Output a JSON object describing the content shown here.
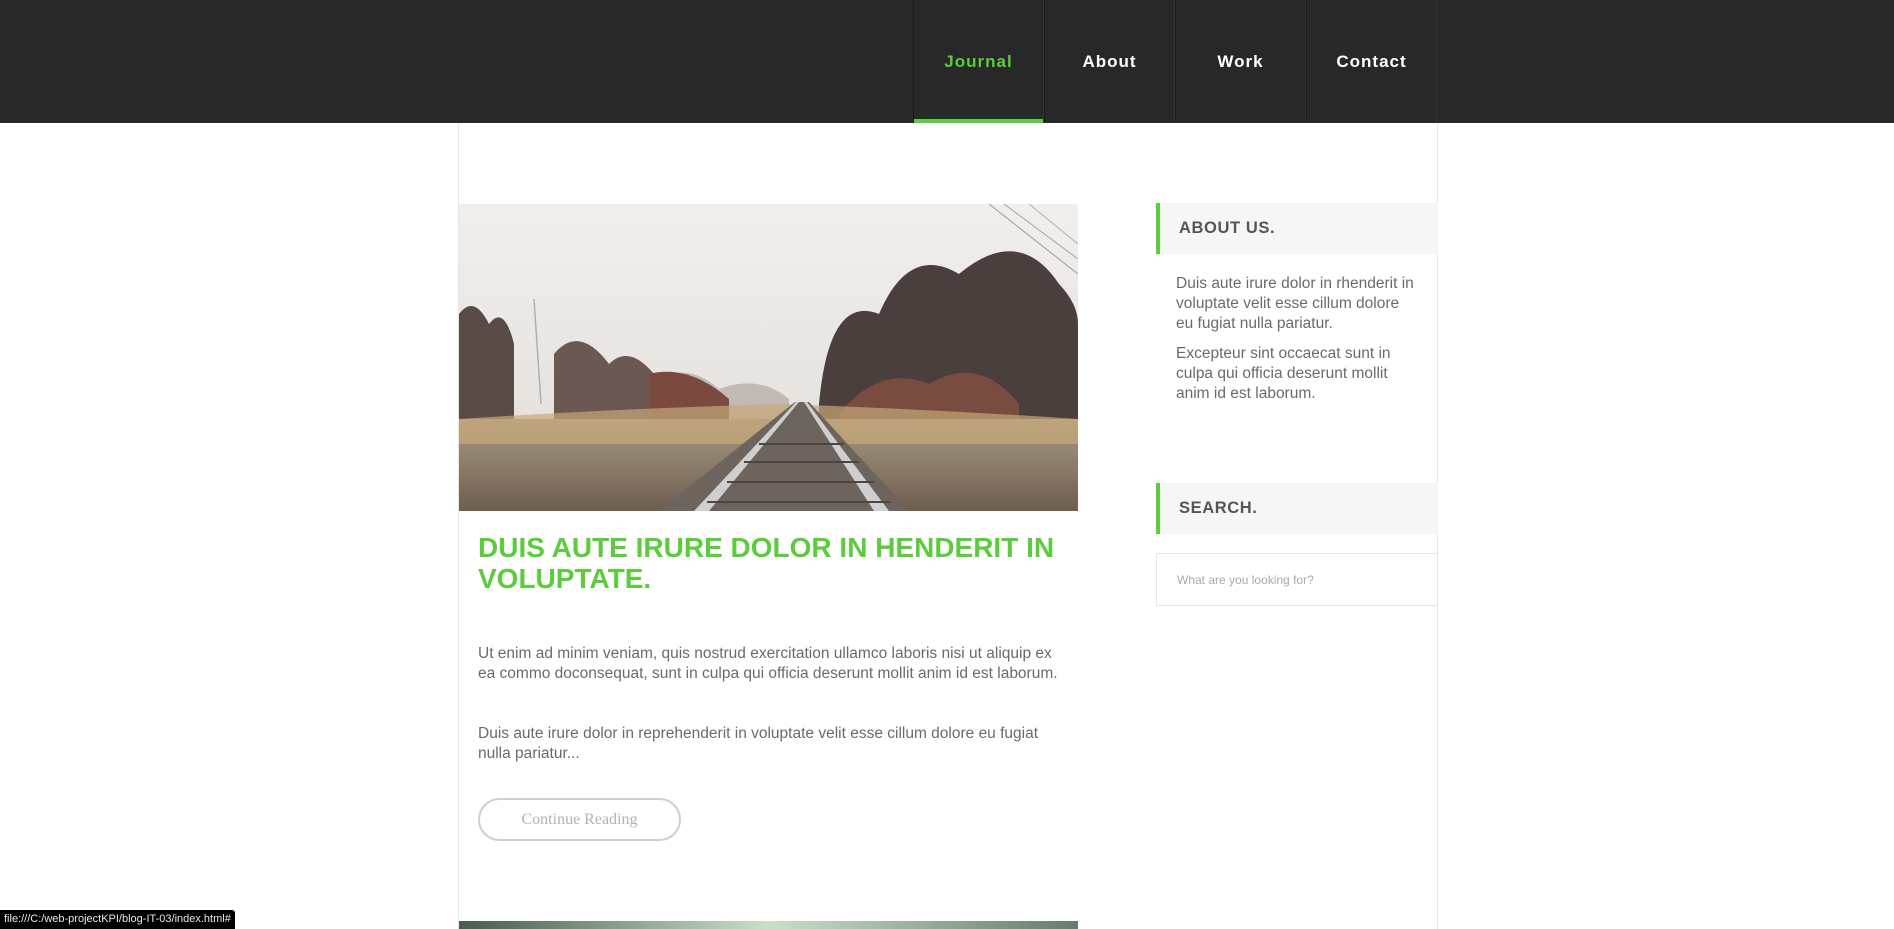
{
  "nav": {
    "items": [
      {
        "label": "Journal",
        "active": true
      },
      {
        "label": "About",
        "active": false
      },
      {
        "label": "Work",
        "active": false
      },
      {
        "label": "Contact",
        "active": false
      }
    ]
  },
  "post": {
    "image_alt": "railway-tracks-image",
    "title": "DUIS AUTE IRURE DOLOR IN HENDERIT IN VOLUPTATE.",
    "paragraphs": [
      "Ut enim ad minim veniam, quis nostrud exercitation ullamco laboris nisi ut aliquip ex ea commo doconsequat, sunt in culpa qui officia deserunt mollit anim id est laborum.",
      "Duis aute irure dolor in reprehenderit in voluptate velit esse cillum dolore eu fugiat nulla pariatur..."
    ],
    "continue_label": "Continue Reading"
  },
  "sidebar": {
    "about": {
      "title": "ABOUT US.",
      "paragraphs": [
        "Duis aute irure dolor in rhenderit in voluptate velit esse cillum dolore eu fugiat nulla pariatur.",
        "Excepteur sint occaecat sunt in culpa qui officia deserunt mollit anim id est laborum."
      ]
    },
    "search": {
      "title": "SEARCH.",
      "placeholder": "What are you looking for?"
    }
  },
  "status_bar": {
    "url": "file:///C:/web-projectKPI/blog-IT-03/index.html#"
  },
  "colors": {
    "accent": "#5ccc3c",
    "header_bg": "#282828",
    "text": "#6a6a6a"
  }
}
